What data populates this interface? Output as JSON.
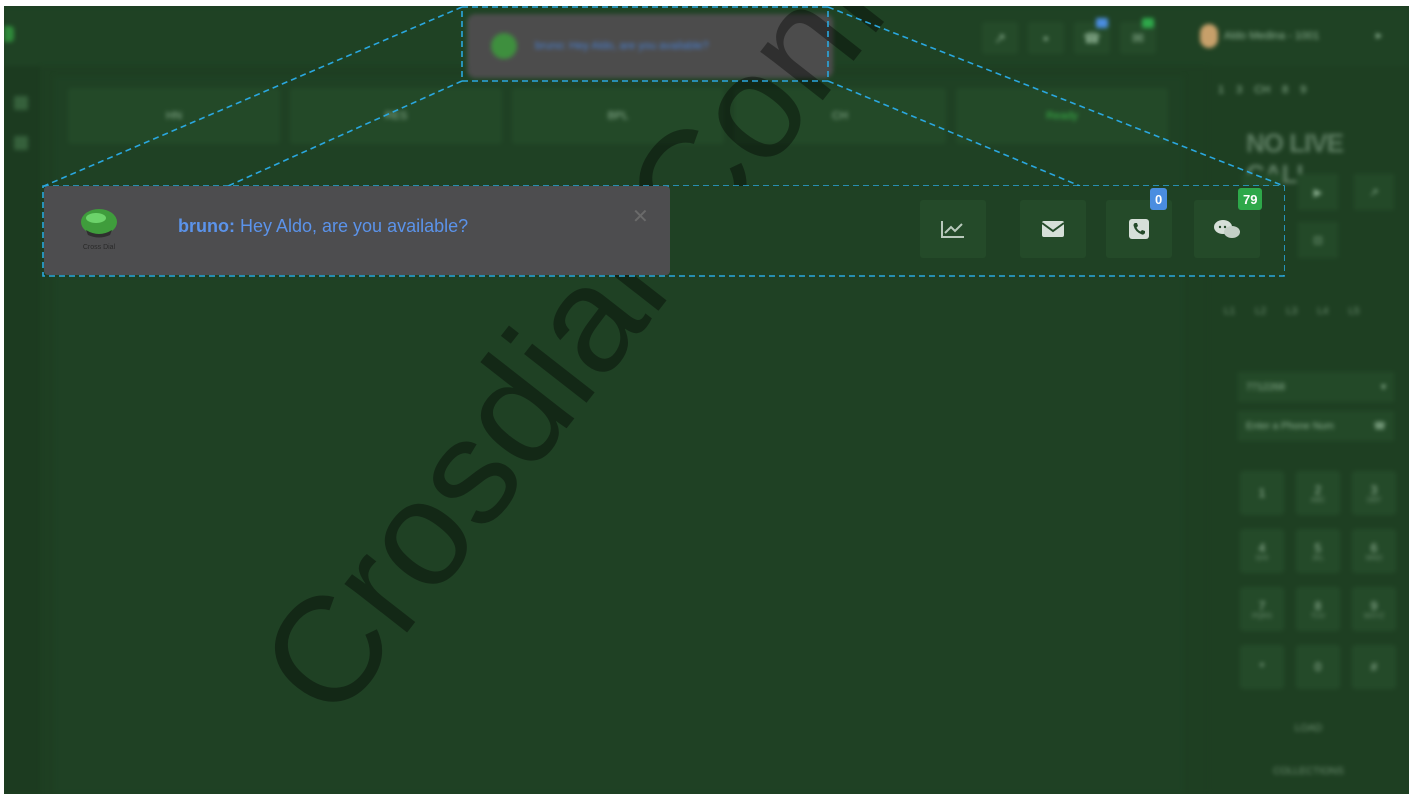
{
  "top_toast": {
    "message": "bruno: Hey Aldo, are you available?"
  },
  "header": {
    "user_label": "Aldo Medina - 1001",
    "icons": [
      "chart-icon",
      "trash-icon",
      "phone-icon",
      "chat-icon"
    ]
  },
  "stat_cards": [
    {
      "label": "HN",
      "active": false
    },
    {
      "label": "RES",
      "active": false
    },
    {
      "label": "BPL",
      "active": false
    },
    {
      "label": "CH",
      "active": false
    },
    {
      "label": "Ready",
      "active": true
    }
  ],
  "right_panel": {
    "numbers": [
      "1",
      "3",
      "CH",
      "8",
      "9"
    ],
    "status_title": "NO LIVE CALL",
    "row_labels": [
      "L1",
      "L2",
      "L3",
      "L4",
      "L5"
    ],
    "caller_id_select": "7712268",
    "phone_input_placeholder": "Enter a Phone Num",
    "keypad": [
      {
        "digit": "1",
        "letters": ""
      },
      {
        "digit": "2",
        "letters": "ABC"
      },
      {
        "digit": "3",
        "letters": "DEF"
      },
      {
        "digit": "4",
        "letters": "GHI"
      },
      {
        "digit": "5",
        "letters": "JKL"
      },
      {
        "digit": "6",
        "letters": "MNO"
      },
      {
        "digit": "7",
        "letters": "PQRS"
      },
      {
        "digit": "8",
        "letters": "TUV"
      },
      {
        "digit": "9",
        "letters": "WXYZ"
      },
      {
        "digit": "*",
        "letters": ""
      },
      {
        "digit": "0",
        "letters": ""
      },
      {
        "digit": "#",
        "letters": ""
      }
    ],
    "footer_1": "LOAD",
    "footer_2": "COLLECTIONS"
  },
  "toast": {
    "sender": "bruno:",
    "message": " Hey Aldo, are you available?",
    "logo_text": "Cross Dial",
    "close_symbol": "✕"
  },
  "actions": {
    "call_badge": "0",
    "chat_badge": "79",
    "badge_colors": {
      "call": "#4a8de0",
      "chat": "#2ea84a"
    }
  },
  "watermark": "Crosdial Config"
}
